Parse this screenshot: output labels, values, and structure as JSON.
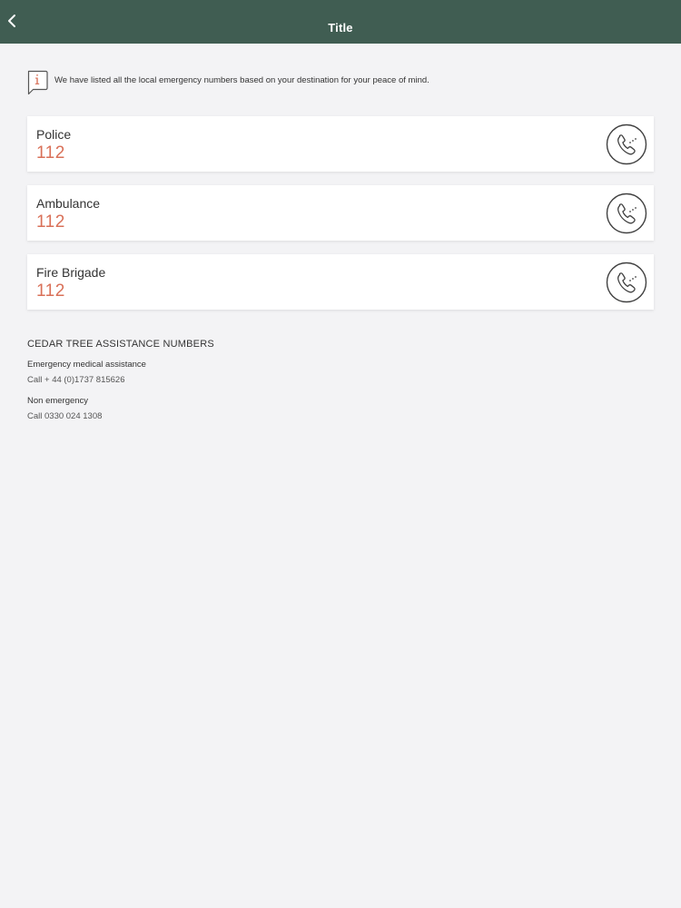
{
  "header": {
    "title": "Title",
    "back_icon": "chevron-left-icon"
  },
  "info": {
    "icon": "info-speech-bubble-icon",
    "text": "We have listed all the local emergency numbers based on your destination for your peace of mind."
  },
  "emergency_numbers": [
    {
      "label": "Police",
      "number": "112",
      "call_icon": "phone-call-icon"
    },
    {
      "label": "Ambulance",
      "number": "112",
      "call_icon": "phone-call-icon"
    },
    {
      "label": "Fire Brigade",
      "number": "112",
      "call_icon": "phone-call-icon"
    }
  ],
  "assistance": {
    "heading": "CEDAR TREE ASSISTANCE NUMBERS",
    "items": [
      {
        "label": "Emergency medical assistance",
        "number": "Call + 44 (0)1737 815626"
      },
      {
        "label": "Non emergency",
        "number": "Call 0330 024 1308"
      }
    ]
  },
  "colors": {
    "header_bg": "#405d52",
    "accent_number": "#d97058",
    "page_bg": "#f3f3f5"
  }
}
